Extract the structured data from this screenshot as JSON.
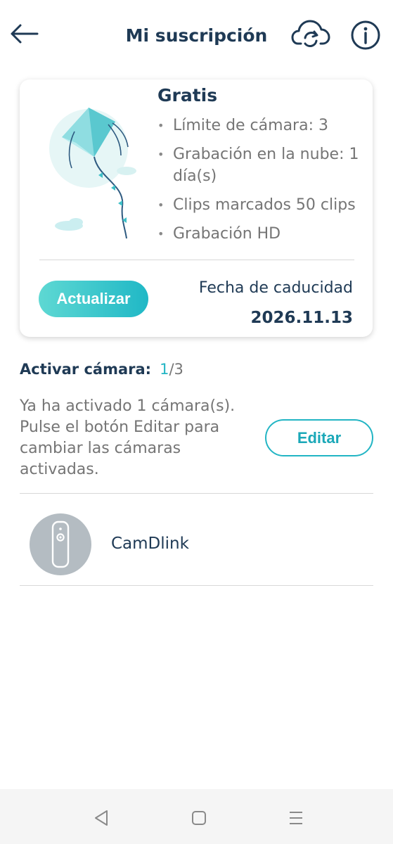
{
  "header": {
    "title": "Mi suscripción",
    "back_icon": "arrow-left-icon",
    "cloud_icon": "cloud-sync-icon",
    "info_icon": "info-icon"
  },
  "plan": {
    "name": "Gratis",
    "features": [
      "Límite de cámara: 3",
      "Grabación en la nube: 1 día(s)",
      "Clips marcados 50 clips",
      "Grabación HD"
    ],
    "upgrade_label": "Actualizar",
    "expiry_label": "Fecha de caducidad",
    "expiry_date": "2026.11.13"
  },
  "activation": {
    "label": "Activar cámara:",
    "count": "1",
    "total": "/3",
    "description": "Ya ha activado 1 cámara(s). Pulse el botón Editar para cambiar las cámaras activadas.",
    "edit_label": "Editar"
  },
  "cameras": [
    {
      "name": "CamDlink"
    }
  ],
  "colors": {
    "accent": "#22b5c4",
    "title": "#1f3a55",
    "muted": "#757575"
  }
}
